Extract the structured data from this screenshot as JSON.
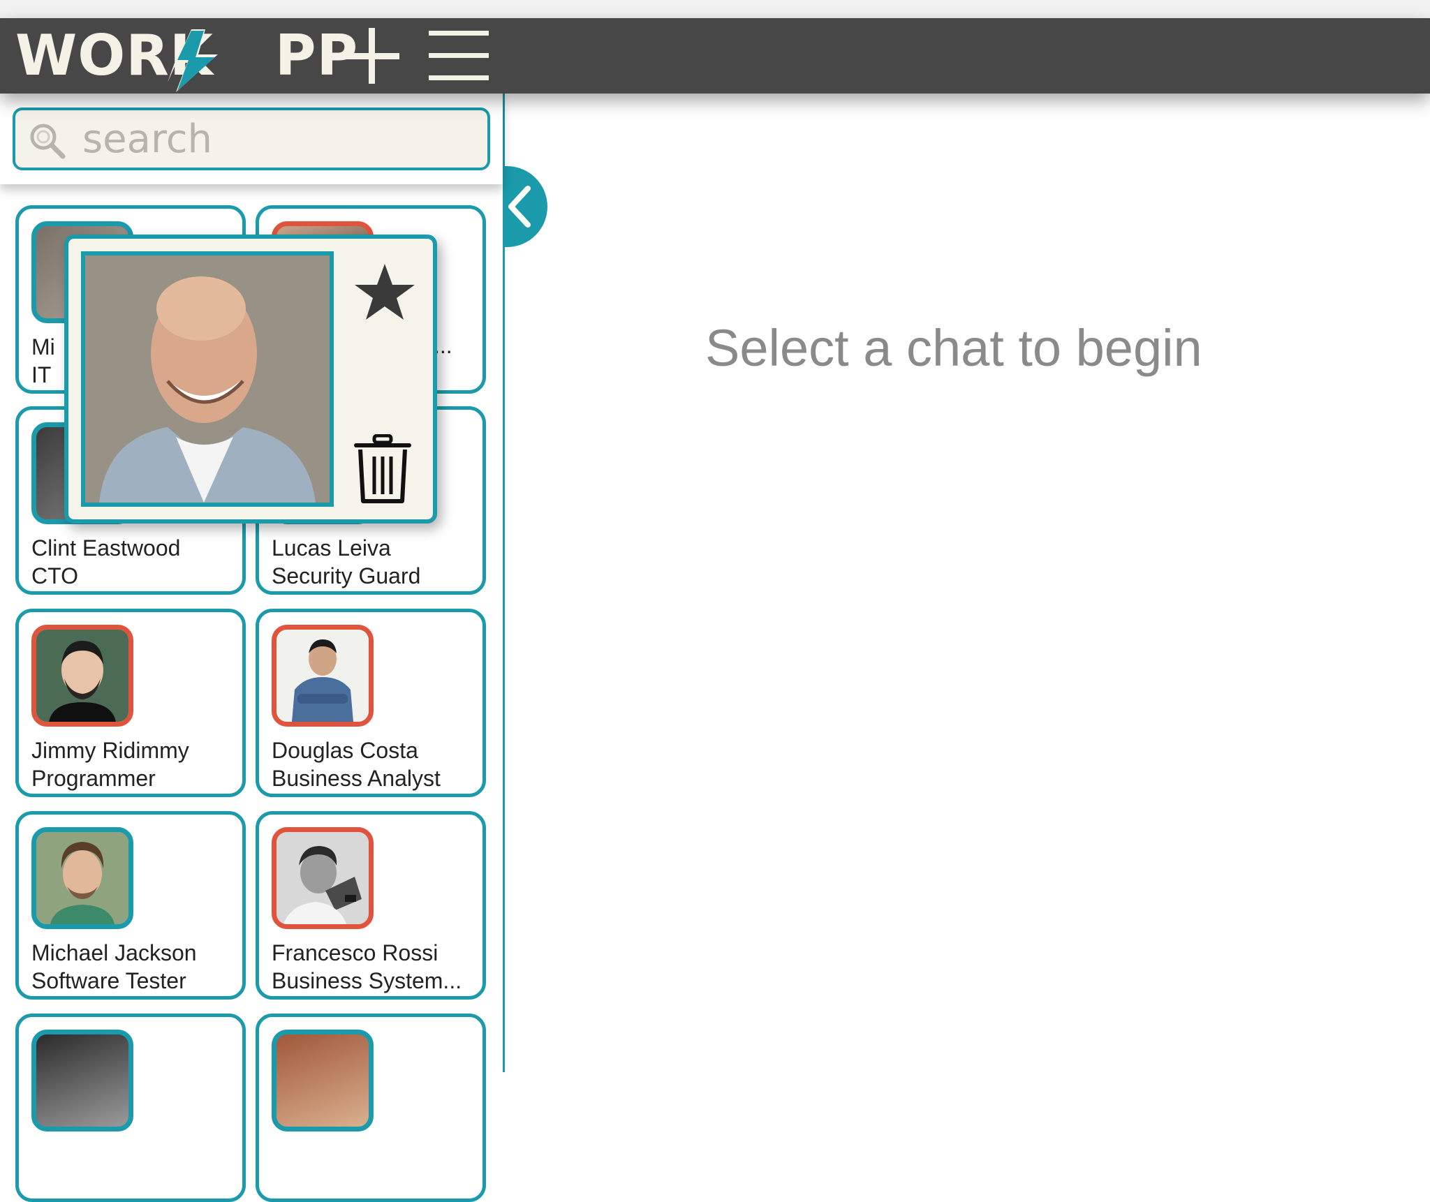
{
  "app": {
    "logo_text_a": "WORK",
    "logo_text_b": "PP"
  },
  "toolbar": {
    "add_icon": "plus-icon",
    "menu_icon": "hamburger-icon"
  },
  "search": {
    "placeholder": "search"
  },
  "contacts": [
    {
      "name": "Mi",
      "role": "IT",
      "status_color": "#1a9aab"
    },
    {
      "name": "",
      "role": "...",
      "status_color": "#e0533c"
    },
    {
      "name": "Clint Eastwood",
      "role": "CTO",
      "status_color": "#1a9aab"
    },
    {
      "name": "Lucas Leiva",
      "role": "Security Guard",
      "status_color": "#1a9aab"
    },
    {
      "name": "Jimmy Ridimmy",
      "role": "Programmer",
      "status_color": "#e0533c"
    },
    {
      "name": "Douglas Costa",
      "role": "Business Analyst",
      "status_color": "#e0533c"
    },
    {
      "name": "Michael Jackson",
      "role": "Software Tester",
      "status_color": "#1a9aab"
    },
    {
      "name": "Francesco Rossi",
      "role": "Business System...",
      "status_color": "#e0533c"
    },
    {
      "name": "",
      "role": "",
      "status_color": "#1a9aab"
    },
    {
      "name": "",
      "role": "",
      "status_color": "#1a9aab"
    }
  ],
  "popup": {
    "star_icon": "star-icon",
    "trash_icon": "trash-icon"
  },
  "main": {
    "empty_message": "Select a chat to begin"
  },
  "colors": {
    "accent": "#1a9aab",
    "busy": "#e0533c",
    "appbar": "#474747",
    "cream": "#f4f3ea"
  }
}
